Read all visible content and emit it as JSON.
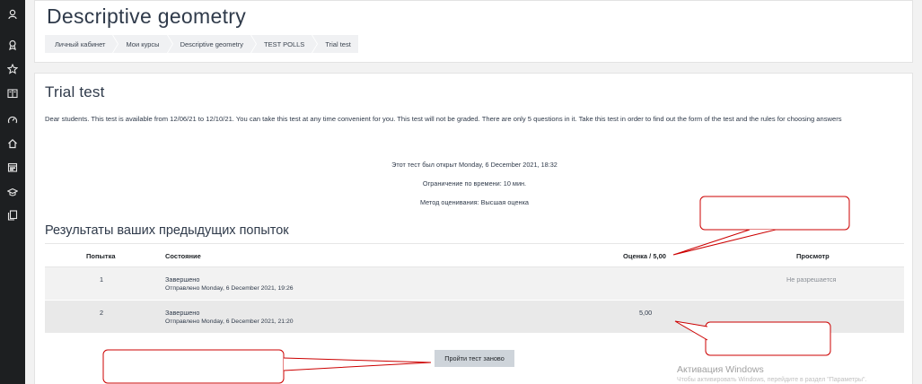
{
  "sidebar": {
    "icons": [
      "badge-icon",
      "award-icon",
      "star-icon",
      "book-icon",
      "gauge-icon",
      "home-icon",
      "calendar-icon",
      "graduation-cap-icon",
      "files-icon"
    ]
  },
  "header": {
    "title": "Descriptive geometry",
    "breadcrumb": [
      "Личный кабинет",
      "Мои курсы",
      "Descriptive geometry",
      "TEST POLLS",
      "Trial test"
    ]
  },
  "quiz": {
    "title": "Trial test",
    "intro": "Dear students. This test is available from 12/06/21 to 12/10/21.  You can take this test at any time convenient for you. This test will not be graded. There are only 5 questions in it. Take this test in order to find out the form of the test and the rules for choosing answers",
    "opened": "Этот тест был открыт Monday, 6 December 2021, 18:32",
    "time_limit": "Ограничение по времени: 10 мин.",
    "grading_method": "Метод оценивания: Высшая оценка"
  },
  "results": {
    "heading": "Результаты ваших предыдущих попыток",
    "columns": {
      "attempt": "Попытка",
      "state": "Состояние",
      "grade": "Оценка / 5,00",
      "review": "Просмотр"
    },
    "rows": [
      {
        "attempt": "1",
        "state": "Завершено",
        "submitted": "Отправлено Monday, 6 December 2021, 19:26",
        "grade": "",
        "review": "Не разрешается"
      },
      {
        "attempt": "2",
        "state": "Завершено",
        "submitted": "Отправлено Monday, 6 December 2021, 21:20",
        "grade": "5,00",
        "review": ""
      }
    ]
  },
  "retake_button": "Пройти тест заново",
  "watermark": {
    "title": "Активация Windows",
    "subtitle": "Чтобы активировать Windows, перейдите в раздел \"Параметры\"."
  },
  "colors": {
    "annotation": "#cc0000",
    "sidebar": "#1d1f21",
    "button": "#ced4da"
  }
}
